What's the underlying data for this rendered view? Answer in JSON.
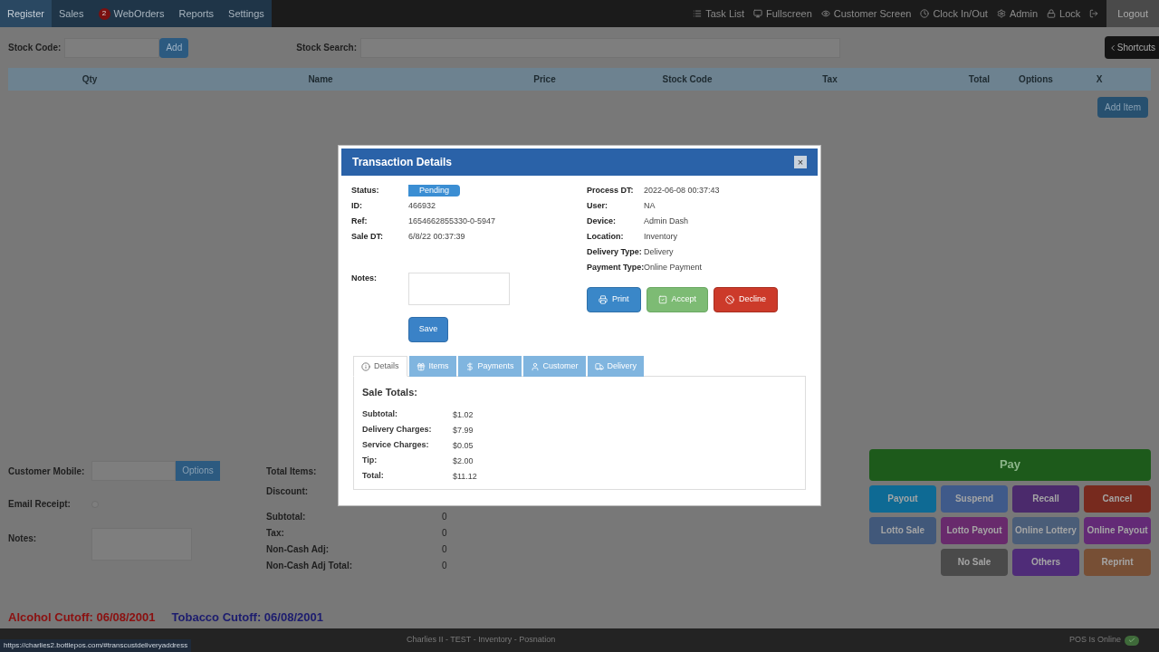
{
  "nav": {
    "items": [
      {
        "label": "Register",
        "selected": true
      },
      {
        "label": "Sales",
        "selected": false
      },
      {
        "label": "WebOrders",
        "badge": "2",
        "selected": false
      },
      {
        "label": "Reports",
        "selected": false
      },
      {
        "label": "Settings",
        "selected": false
      }
    ],
    "right_items": [
      {
        "label": "Task List",
        "kind": "list"
      },
      {
        "label": "Fullscreen",
        "kind": "monitor"
      },
      {
        "label": "Customer Screen",
        "kind": "eye"
      },
      {
        "label": "Clock In/Out",
        "kind": "clock"
      },
      {
        "label": "Admin",
        "kind": "gear"
      },
      {
        "label": "Lock",
        "kind": "lock"
      },
      {
        "kind": "exit"
      }
    ],
    "logout": "Logout"
  },
  "stock": {
    "code_label": "Stock Code:",
    "add": "Add",
    "search_label": "Stock Search:",
    "shortcuts": "Shortcuts"
  },
  "table": {
    "columns": [
      "Qty",
      "Name",
      "Price",
      "Stock Code",
      "Tax",
      "Total",
      "Options",
      "X"
    ],
    "add_item": "Add Item"
  },
  "customer": {
    "mobile_label": "Customer Mobile:",
    "options": "Options",
    "email_label": "Email Receipt:",
    "email_checked": false,
    "notes_label": "Notes:"
  },
  "summary": [
    {
      "label": "Total Items:"
    },
    {
      "label": "Discount:"
    },
    {
      "label": "Subtotal:",
      "value": "0"
    },
    {
      "label": "Tax:",
      "value": "0"
    },
    {
      "label": "Non-Cash Adj:",
      "value": "0"
    },
    {
      "label": "Non-Cash Adj Total:",
      "value": "0"
    }
  ],
  "pay": "Pay",
  "button_rows": [
    [
      {
        "label": "Payout",
        "color": "#0e6a94"
      },
      {
        "label": "Suspend",
        "color": "#3f5a8a"
      },
      {
        "label": "Recall",
        "color": "#4b2a6c"
      },
      {
        "label": "Cancel",
        "color": "#772a1e"
      }
    ],
    [
      {
        "label": "Lotto Sale",
        "color": "#41587a"
      },
      {
        "label": "Lotto Payout",
        "color": "#682a6c"
      },
      {
        "label": "Online Lottery",
        "color": "#4a5d78"
      },
      {
        "label": "Online Payout",
        "color": "#632a76"
      }
    ],
    [
      {
        "label": "No Sale",
        "color": "#4a4a4a"
      },
      {
        "label": "Others",
        "color": "#4f2c78"
      },
      {
        "label": "Reprint",
        "color": "#774f35"
      }
    ]
  ],
  "cutoffs": [
    {
      "text": "Alcohol Cutoff: 06/08/2001",
      "color": "#8b1010"
    },
    {
      "text": "Tobacco Cutoff: 06/08/2001",
      "color": "#1c1c6e"
    }
  ],
  "footer": {
    "center": "Charlies II - TEST - Inventory - Posnation",
    "status": "POS Is Online",
    "url": "https://charlies2.bottlepos.com/#transcustdeliveryaddress"
  },
  "modal": {
    "title": "Transaction Details",
    "close": "×",
    "left": [
      {
        "label": "Status:",
        "value": "Pending",
        "kind": "badge"
      },
      {
        "label": "ID:",
        "value": "466932",
        "kind": "text"
      },
      {
        "label": "Ref:",
        "value": "1654662855330-0-5947",
        "kind": "text"
      },
      {
        "label": "Sale DT:",
        "value": "6/8/22 00:37:39",
        "kind": "text"
      }
    ],
    "right": [
      {
        "label": "Process DT:",
        "value": "2022-06-08 00:37:43"
      },
      {
        "label": "User:",
        "value": "NA"
      },
      {
        "label": "Device:",
        "value": "Admin Dash"
      },
      {
        "label": "Location:",
        "value": "Inventory"
      },
      {
        "label": "Delivery Type:",
        "value": "Delivery"
      },
      {
        "label": "Payment Type:",
        "value": "Online Payment"
      }
    ],
    "notes_label": "Notes:",
    "save": "Save",
    "actions": [
      {
        "label": "Print",
        "kind": "print"
      },
      {
        "label": "Accept",
        "kind": "accept"
      },
      {
        "label": "Decline",
        "kind": "decline"
      }
    ],
    "tabs": [
      {
        "label": "Details",
        "kind": "info",
        "selected": true
      },
      {
        "label": "Items",
        "kind": "gift",
        "selected": false
      },
      {
        "label": "Payments",
        "kind": "dollar",
        "selected": false
      },
      {
        "label": "Customer",
        "kind": "user",
        "selected": false
      },
      {
        "label": "Delivery",
        "kind": "truck",
        "selected": false
      }
    ],
    "totals_title": "Sale Totals:",
    "totals": [
      {
        "label": "Subtotal:",
        "value": "$1.02"
      },
      {
        "label": "Delivery Charges:",
        "value": "$7.99"
      },
      {
        "label": "Service Charges:",
        "value": "$0.05"
      },
      {
        "label": "Tip:",
        "value": "$2.00"
      },
      {
        "label": "Total:",
        "value": "$11.12"
      }
    ]
  }
}
